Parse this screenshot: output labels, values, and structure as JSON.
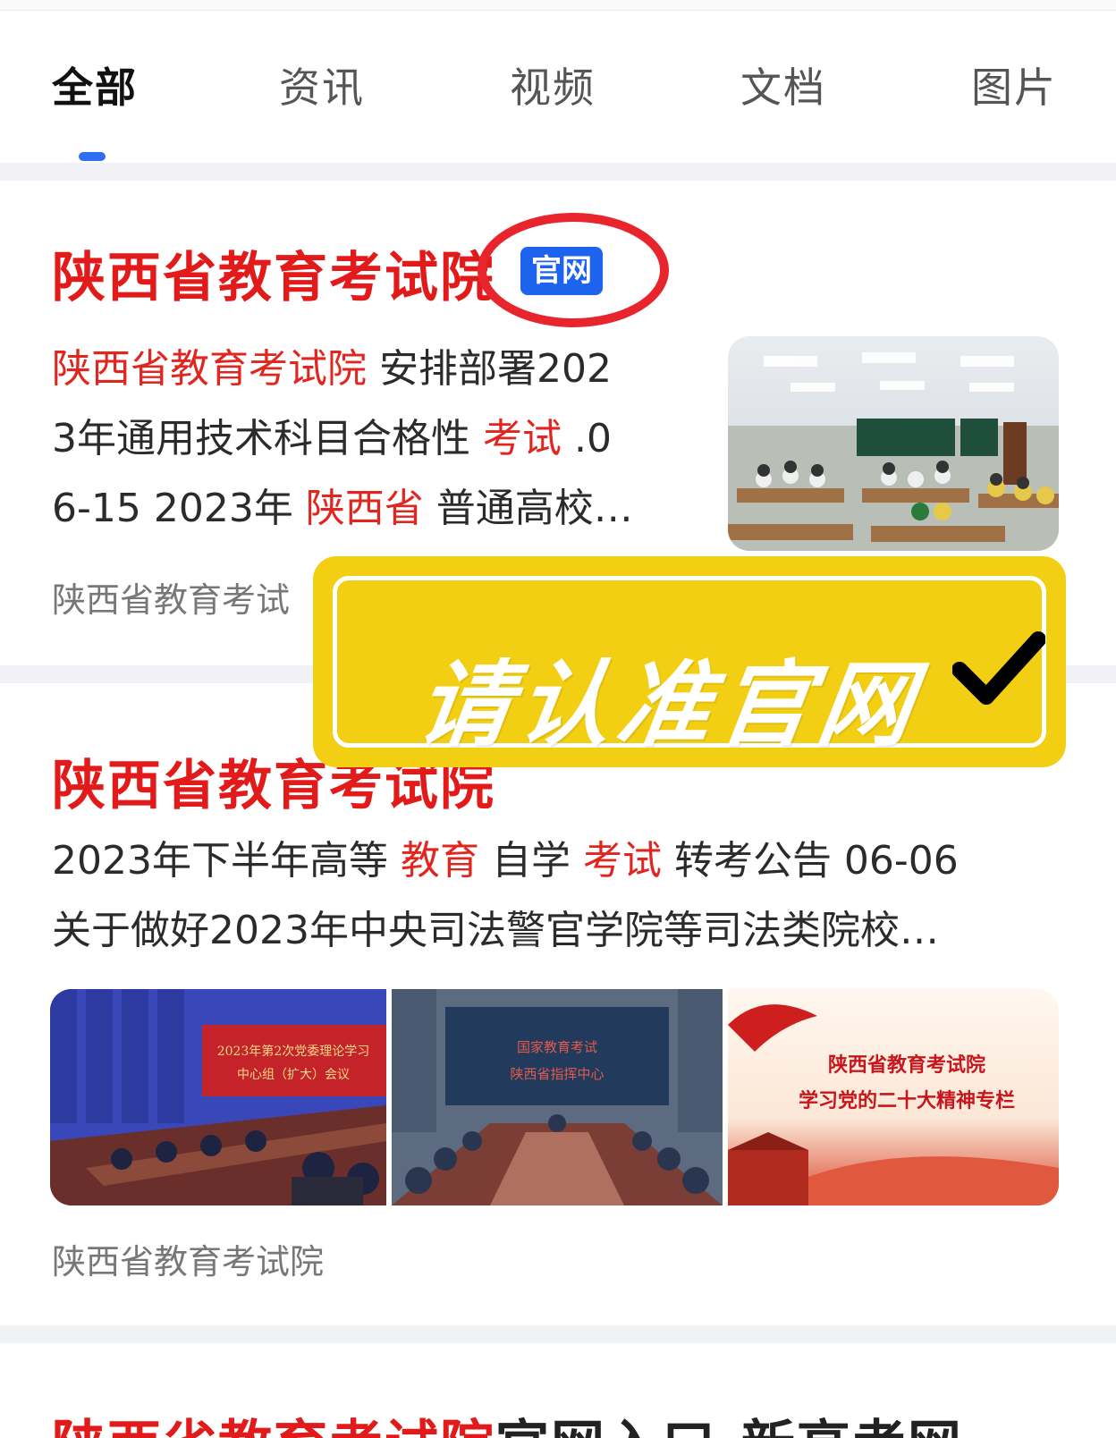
{
  "tabs": [
    {
      "label": "全部",
      "active": true
    },
    {
      "label": "资讯"
    },
    {
      "label": "视频"
    },
    {
      "label": "文档"
    },
    {
      "label": "图片"
    }
  ],
  "result1": {
    "title": "陕西省教育考试院",
    "badge": "官网",
    "snippet": {
      "l1_a": "陕西省教育考试院",
      "l1_b": " 安排部署202",
      "l2_a": "3年通用技术科目合格性 ",
      "l2_b": "考试",
      "l2_c": " .0",
      "l3_a": "6-15 2023年 ",
      "l3_b": "陕西省",
      "l3_c": " 普通高校…"
    },
    "source": "陕西省教育考试"
  },
  "banner": {
    "text": "请认准官网",
    "icon": "checkmark-icon"
  },
  "result2": {
    "title": "陕西省教育考试院",
    "snippet": {
      "l1_a": "2023年下半年高等 ",
      "l1_b": "教育",
      "l1_c": " 自学 ",
      "l1_d": "考试",
      "l1_e": " 转考公告 06-06",
      "l2": "关于做好2023年中央司法警官学院等司法类院校…"
    },
    "images": [
      {
        "caption_l1": "2023年第2次党委理论学习",
        "caption_l2": "中心组（扩大）会议"
      },
      {
        "caption_l1": "国家教育考试",
        "caption_l2": "陕西省指挥中心"
      },
      {
        "caption_l1": "陕西省教育考试院",
        "caption_l2": "学习党的二十大精神专栏"
      }
    ],
    "source": "陕西省教育考试院"
  },
  "result3": {
    "title_a": "陕西省教育考试院",
    "title_b": "官网入口-新高考网"
  },
  "colors": {
    "brand_blue": "#2d6ff0",
    "highlight_red": "#e0261f",
    "banner_yellow": "#f3cf14"
  }
}
